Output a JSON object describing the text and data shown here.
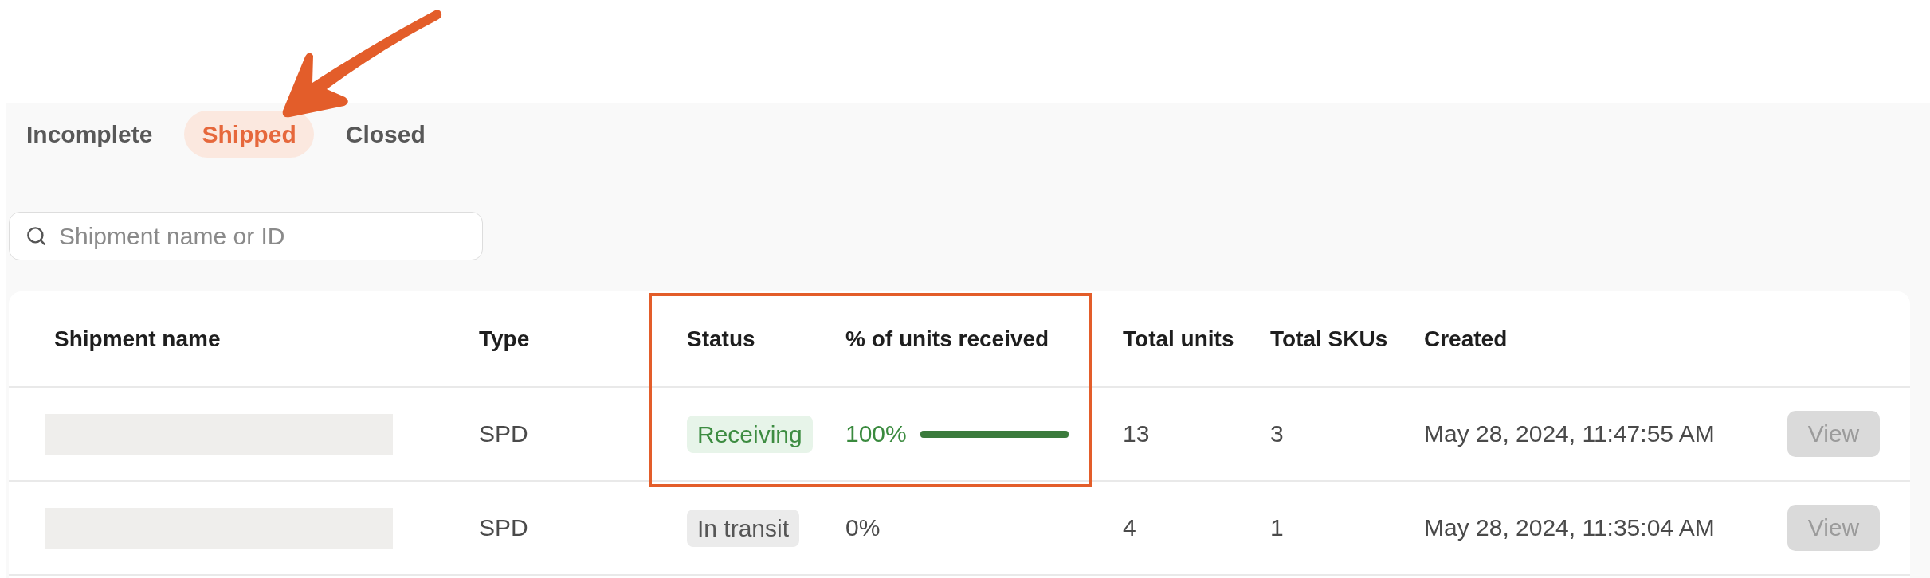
{
  "tabs": [
    {
      "label": "Incomplete",
      "selected": false
    },
    {
      "label": "Shipped",
      "selected": true
    },
    {
      "label": "Closed",
      "selected": false
    }
  ],
  "search": {
    "placeholder": "Shipment name or ID"
  },
  "table": {
    "columns": [
      "Shipment name",
      "Type",
      "Status",
      "% of units received",
      "Total units",
      "Total SKUs",
      "Created"
    ],
    "rows": [
      {
        "name_redacted": true,
        "type": "SPD",
        "status": {
          "label": "Receiving",
          "kind": "receiving"
        },
        "received": {
          "reading": "100%",
          "level": 1
        },
        "total_units": "13",
        "total_skus": "3",
        "created": "May 28, 2024, 11:47:55 AM",
        "action": {
          "label": "View",
          "disabled": true
        }
      },
      {
        "name_redacted": true,
        "type": "SPD",
        "status": {
          "label": "In transit",
          "kind": "in_transit"
        },
        "received": {
          "reading": "0%"
        },
        "total_units": "4",
        "total_skus": "1",
        "created": "May 28, 2024, 11:35:04 AM",
        "action": {
          "label": "View",
          "disabled": true
        }
      }
    ]
  }
}
